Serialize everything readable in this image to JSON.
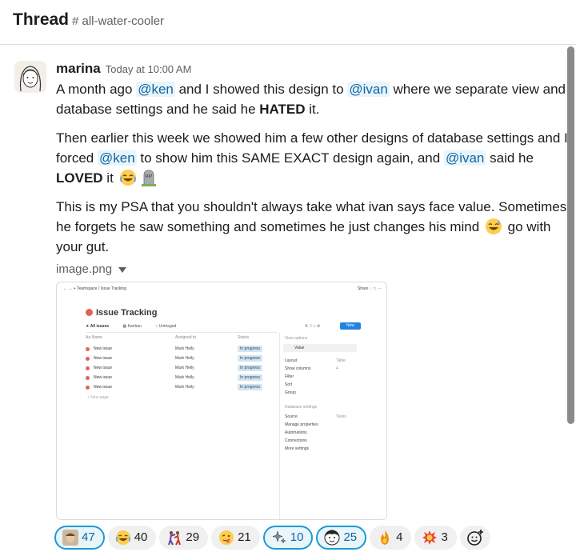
{
  "header": {
    "title": "Thread",
    "channel": "# all-water-cooler"
  },
  "message": {
    "author": "marina",
    "timestamp": "Today at 10:00 AM",
    "p1": {
      "a": "A month ago ",
      "m1": "@ken",
      "b": " and I showed this design to ",
      "m2": "@ivan",
      "c": " where we separate view and database settings and he said he ",
      "bold": "HATED",
      "d": " it."
    },
    "p2": {
      "a": "Then earlier this week we showed him a few other designs of database settings and I forced ",
      "m1": "@ken",
      "b": " to show him this SAME EXACT design again, and ",
      "m2": "@ivan",
      "c": " said he ",
      "bold": "LOVED",
      "d": " it"
    },
    "p3": {
      "a": "This is my PSA that you shouldn't always take what ivan says face value. Sometimes he forgets he saw something and sometimes he just changes his mind ",
      "b": " go with your gut."
    },
    "attachment": {
      "file_name": "image.png",
      "crumbs": "Teamspace / Issue Tracking",
      "share": "Share",
      "page_title": "Issue Tracking",
      "views": {
        "all": "All issues",
        "kanban": "Kanban",
        "untriaged": "Untriaged"
      },
      "new_button": "New",
      "columns": {
        "name": "Aa Name",
        "assigned": "Assigned to",
        "status": "Status"
      },
      "rows": [
        {
          "name": "New issue",
          "assigned": "Mark  Helly",
          "status": "In progress"
        },
        {
          "name": "New issue",
          "assigned": "Mark  Helly",
          "status": "In progress"
        },
        {
          "name": "New issue",
          "assigned": "Mark  Helly",
          "status": "In progress"
        },
        {
          "name": "New issue",
          "assigned": "Mark  Helly",
          "status": "In progress"
        },
        {
          "name": "New issue",
          "assigned": "Mark  Helly",
          "status": "In progress"
        }
      ],
      "new_page": "+ New page",
      "panel": {
        "title": "View options",
        "value": "Value",
        "layout": "Layout",
        "layout_value": "Table",
        "show_columns": "Show columns",
        "show_columns_value": "4",
        "filter": "Filter",
        "sort": "Sort",
        "group": "Group",
        "db_section": "Database settings",
        "source": "Source",
        "source_value": "Tasks",
        "manage_props": "Manage properties",
        "automations": "Automations",
        "connections": "Connections",
        "more": "More settings"
      }
    },
    "reactions": [
      {
        "emoji": "avatar-face",
        "count": "47",
        "mine": true
      },
      {
        "emoji": "joy",
        "count": "40",
        "mine": false
      },
      {
        "emoji": "people-fighting",
        "count": "29",
        "mine": false
      },
      {
        "emoji": "face-with-tongue",
        "count": "21",
        "mine": false
      },
      {
        "emoji": "sparkles",
        "count": "10",
        "mine": true
      },
      {
        "emoji": "face-avatar",
        "count": "25",
        "mine": true
      },
      {
        "emoji": "fire",
        "count": "4",
        "mine": false
      },
      {
        "emoji": "explosion",
        "count": "3",
        "mine": false
      }
    ]
  }
}
